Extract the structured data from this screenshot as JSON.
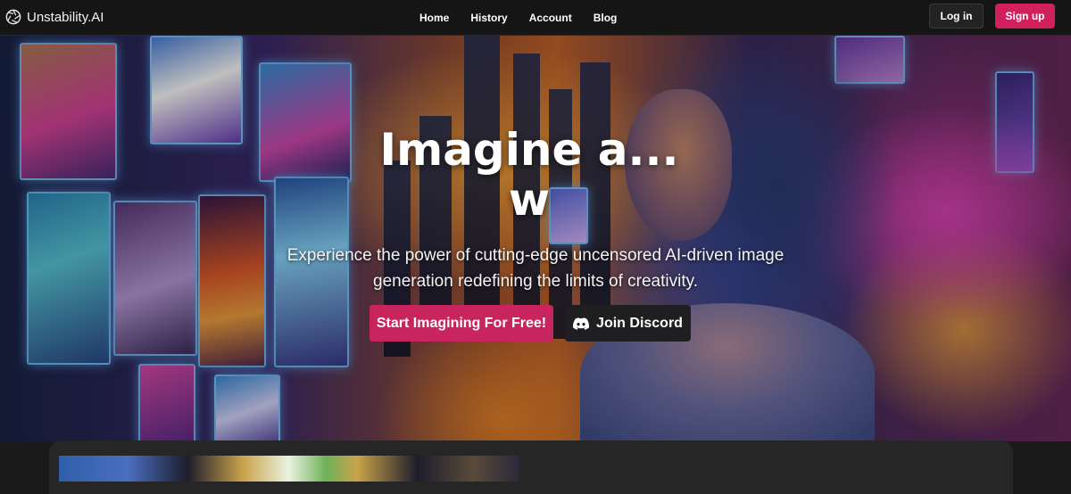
{
  "brand": {
    "name": "Unstability.AI",
    "icon": "aperture-logo-icon"
  },
  "nav": {
    "links": [
      {
        "label": "Home"
      },
      {
        "label": "History"
      },
      {
        "label": "Account"
      },
      {
        "label": "Blog"
      }
    ],
    "login_label": "Log in",
    "signup_label": "Sign up"
  },
  "hero": {
    "title_line1": "Imagine a...",
    "title_line2": "w",
    "subtitle": "Experience the power of cutting-edge uncensored AI-driven image generation redefining the limits of creativity.",
    "cta_primary": "Start Imagining For Free!",
    "cta_secondary": "Join Discord",
    "cta_secondary_icon": "discord-icon"
  },
  "colors": {
    "accent": "#d0215e",
    "navbar_bg": "#151515",
    "dark_button": "#1f1f22",
    "card_bg": "#262626"
  }
}
